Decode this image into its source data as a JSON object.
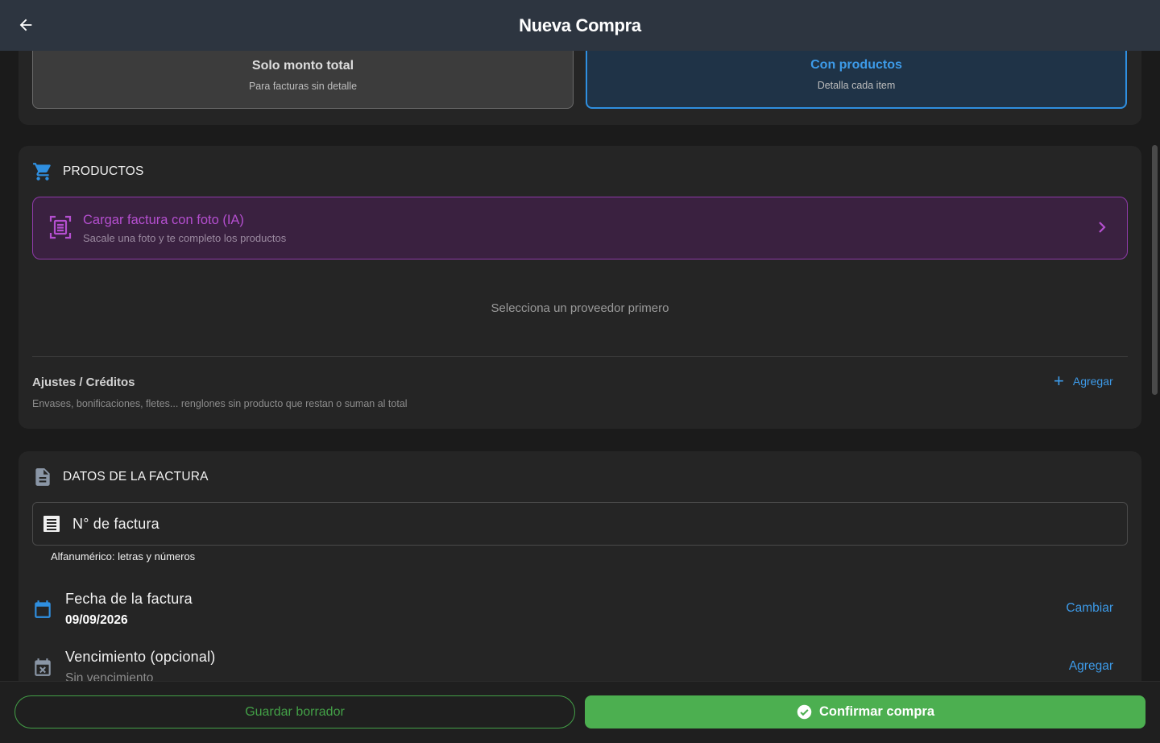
{
  "header": {
    "title": "Nueva Compra"
  },
  "mode": {
    "total": {
      "title": "Solo monto total",
      "subtitle": "Para facturas sin detalle"
    },
    "products": {
      "title": "Con productos",
      "subtitle": "Detalla cada item"
    }
  },
  "products": {
    "heading": "PRODUCTOS",
    "ia": {
      "title": "Cargar factura con foto (IA)",
      "subtitle": "Sacale una foto y te completo los productos"
    },
    "empty": "Selecciona un proveedor primero",
    "adjustments": {
      "title": "Ajustes / Créditos",
      "description": "Envases, bonificaciones, fletes... renglones sin producto que restan o suman al total",
      "add_label": "Agregar"
    }
  },
  "invoice": {
    "heading": "DATOS DE LA FACTURA",
    "number_label": "N° de factura",
    "number_helper": "Alfanumérico: letras y números",
    "date": {
      "label": "Fecha de la factura",
      "value": "09/09/2026",
      "action": "Cambiar"
    },
    "due": {
      "label": "Vencimiento (opcional)",
      "value": "Sin vencimiento",
      "action": "Agregar"
    }
  },
  "footer": {
    "draft_label": "Guardar borrador",
    "confirm_label": "Confirmar compra"
  },
  "colors": {
    "accent_blue": "#3d9be9",
    "accent_purple": "#b54fd0",
    "accent_green": "#4caf50",
    "appbar": "#2d3540"
  }
}
